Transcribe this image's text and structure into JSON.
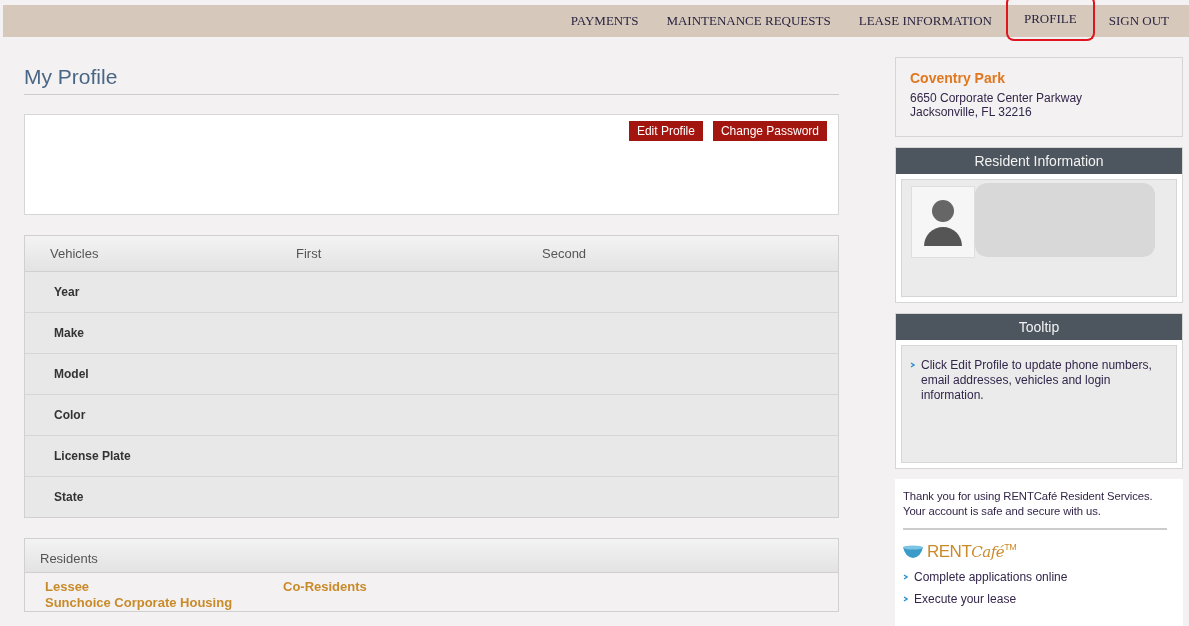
{
  "nav": [
    {
      "label": "PAYMENTS",
      "selected": false
    },
    {
      "label": "MAINTENANCE REQUESTS",
      "selected": false
    },
    {
      "label": "LEASE INFORMATION",
      "selected": false
    },
    {
      "label": "PROFILE",
      "selected": true
    },
    {
      "label": "SIGN OUT",
      "selected": false
    }
  ],
  "page_title": "My Profile",
  "profile_buttons": [
    "Edit Profile",
    "Change Password"
  ],
  "vehicles": {
    "columns": [
      "Vehicles",
      "First",
      "Second"
    ],
    "rows": [
      "Year",
      "Make",
      "Model",
      "Color",
      "License Plate",
      "State"
    ]
  },
  "residents": {
    "title": "Residents",
    "columns": [
      {
        "label": "Lessee",
        "names": [
          "Sunchoice Corporate Housing"
        ]
      },
      {
        "label": "Co-Residents"
      }
    ]
  },
  "property": {
    "name": "Coventry Park",
    "address": [
      "6650 Corporate Center Parkway",
      "Jacksonville, FL 32216"
    ]
  },
  "resident_info": {
    "title": "Resident Information"
  },
  "tooltip": {
    "title": "Tooltip",
    "items": [
      "Click Edit Profile to update phone numbers, email addresses, vehicles and login information."
    ]
  },
  "promo": {
    "text": "Thank you for using RENTCafé Resident Services. Your account is safe and secure with us.",
    "logo": {
      "main": "RENT",
      "script": "Café",
      "mark": "TM"
    },
    "items": [
      "Complete applications online",
      "Execute your lease"
    ]
  }
}
